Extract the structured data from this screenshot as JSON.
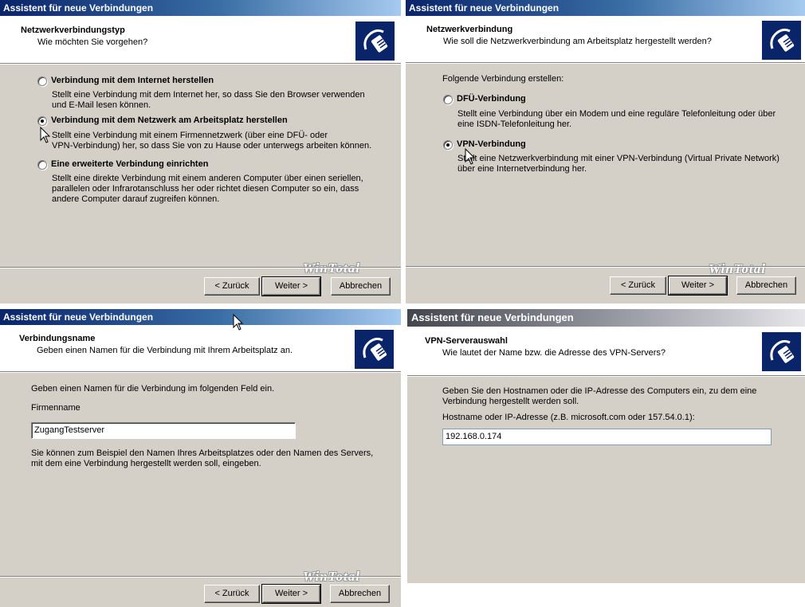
{
  "window_title": "Assistent für neue Verbindungen",
  "watermark": "WinTotal",
  "icons": {
    "logo": "network-cable-icon",
    "cursor": "mouse-pointer-icon"
  },
  "colors": {
    "titlebar_classic": "#0a246a",
    "titlebar_xp": "#44464e",
    "dialog_bg": "#d4d0c8"
  },
  "buttons": {
    "back": "< Zurück",
    "next": "Weiter >",
    "cancel": "Abbrechen"
  },
  "panel1": {
    "header_title": "Netzwerkverbindungstyp",
    "header_subtitle": "Wie möchten Sie vorgehen?",
    "options": [
      {
        "label": "Verbindung mit dem Internet herstellen",
        "checked": false,
        "desc1": "Stellt eine Verbindung mit dem Internet her, so dass Sie den Browser verwenden",
        "desc2": "und E-Mail lesen können."
      },
      {
        "label": "Verbindung mit dem Netzwerk am Arbeitsplatz herstellen",
        "checked": true,
        "desc1": "Stellt eine Verbindung mit einem Firmennetzwerk (über eine DFÜ- oder",
        "desc2": "VPN-Verbindung) her, so dass Sie von zu Hause oder unterwegs arbeiten können."
      },
      {
        "label": "Eine erweiterte Verbindung einrichten",
        "checked": false,
        "desc1": "Stellt eine direkte Verbindung mit einem anderen Computer über einen seriellen,",
        "desc2": "parallelen oder Infrarotanschluss her oder richtet diesen Computer so ein, dass",
        "desc3": "andere Computer darauf zugreifen können."
      }
    ]
  },
  "panel2": {
    "header_title": "Netzwerkverbindung",
    "header_subtitle": "Wie soll die Netzwerkverbindung am Arbeitsplatz hergestellt werden?",
    "intro": "Folgende Verbindung erstellen:",
    "options": [
      {
        "label": "DFÜ-Verbindung",
        "checked": false,
        "desc1": "Stellt eine Verbindung über ein Modem und eine reguläre Telefonleitung oder über",
        "desc2": "eine ISDN-Telefonleitung her."
      },
      {
        "label": "VPN-Verbindung",
        "checked": true,
        "desc1": "Stellt eine Netzwerkverbindung mit einer VPN-Verbindung (Virtual Private Network)",
        "desc2": "über eine Internetverbindung her."
      }
    ]
  },
  "panel3": {
    "header_title": "Verbindungsname",
    "header_subtitle": "Geben einen Namen für die Verbindung mit Ihrem Arbeitsplatz an.",
    "intro": "Geben einen Namen für die Verbindung im folgenden Feld ein.",
    "field_label": "Firmenname",
    "field_value": "ZugangTestserver",
    "note1": "Sie können zum Beispiel den Namen Ihres Arbeitsplatzes oder den Namen des Servers,",
    "note2": "mit dem eine Verbindung hergestellt werden soll, eingeben."
  },
  "panel4": {
    "header_title": "VPN-Serverauswahl",
    "header_subtitle": "Wie lautet der Name bzw. die Adresse des VPN-Servers?",
    "intro1": "Geben Sie den Hostnamen oder die IP-Adresse des Computers ein, zu dem eine",
    "intro2": "Verbindung hergestellt werden soll.",
    "field_label": "Hostname oder IP-Adresse (z.B. microsoft.com oder 157.54.0.1):",
    "field_value": "192.168.0.174"
  }
}
